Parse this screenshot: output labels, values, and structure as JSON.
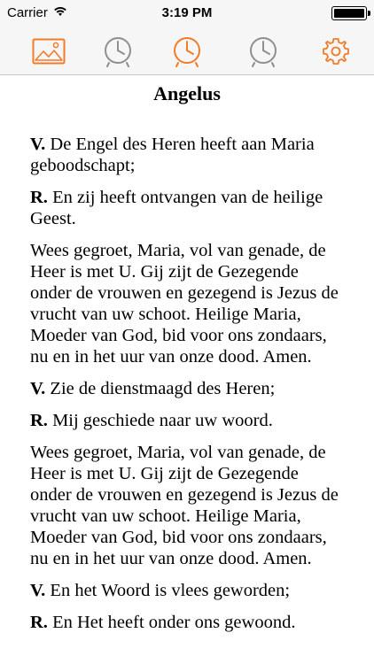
{
  "status_bar": {
    "carrier": "Carrier",
    "time": "3:19 PM",
    "battery_level": 1.0
  },
  "toolbar": {
    "accent_color": "#f07c29",
    "inactive_color": "#8e8e93",
    "items": [
      {
        "name": "image-icon",
        "active": true
      },
      {
        "name": "clock-icon",
        "active": false
      },
      {
        "name": "clock-icon",
        "active": true
      },
      {
        "name": "clock-icon",
        "active": false
      },
      {
        "name": "gear-icon",
        "active": true
      }
    ]
  },
  "prayer": {
    "title": "Angelus",
    "paragraphs": [
      {
        "marker": "V.",
        "text": " De Engel des Heren heeft aan Maria geboodschapt;"
      },
      {
        "marker": "R.",
        "text": " En zij heeft ontvangen van de heilige Geest."
      },
      {
        "marker": "",
        "text": "Wees gegroet, Maria, vol van genade, de Heer is met U. Gij zijt de Gezegende onder de vrouwen en gezegend is Jezus de vrucht van uw schoot. Heilige Maria, Moeder van God, bid voor ons zondaars, nu en in het uur van onze dood. Amen."
      },
      {
        "marker": "V.",
        "text": " Zie de dienstmaagd des Heren;"
      },
      {
        "marker": "R.",
        "text": " Mij geschiede naar uw woord."
      },
      {
        "marker": "",
        "text": "Wees gegroet, Maria, vol van genade, de Heer is met U. Gij zijt de Gezegende onder de vrouwen en gezegend is Jezus de vrucht van uw schoot. Heilige Maria, Moeder van God, bid voor ons zondaars, nu en in het uur van onze dood. Amen."
      },
      {
        "marker": "V.",
        "text": " En het Woord is vlees geworden;"
      },
      {
        "marker": "R.",
        "text": " En Het heeft onder ons gewoond."
      }
    ]
  }
}
